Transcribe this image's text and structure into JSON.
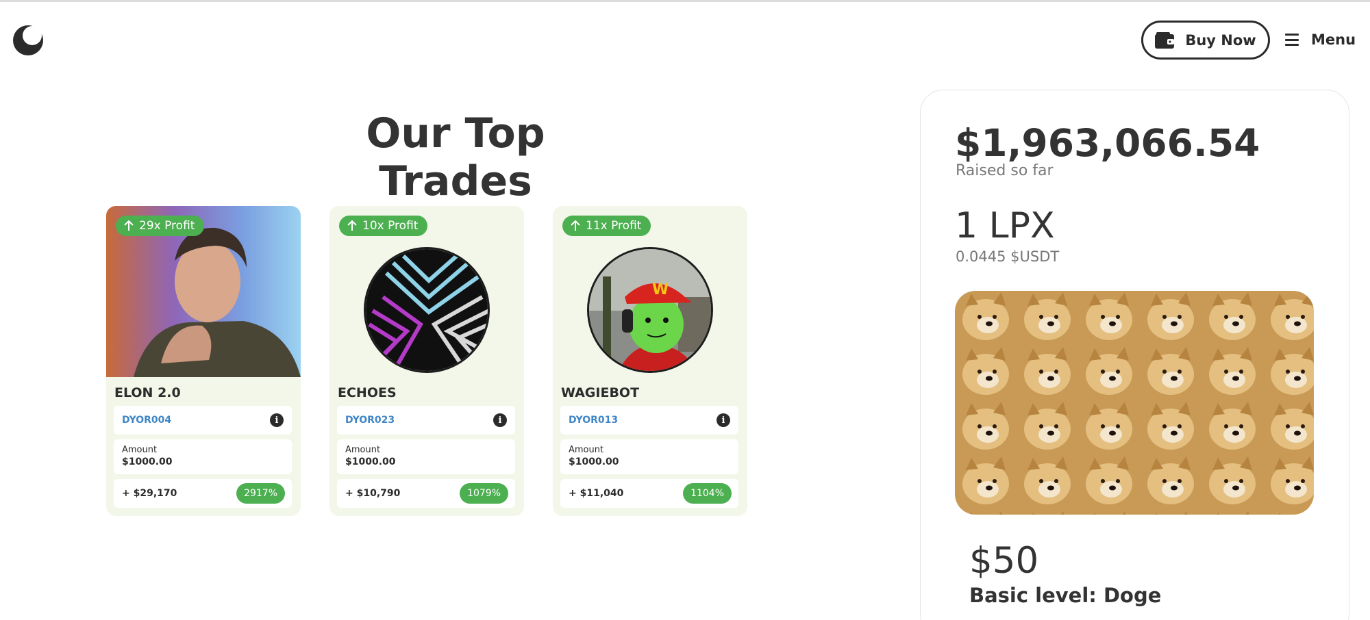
{
  "header": {
    "logo_icon": "crescent-logo",
    "buy_label": "Buy Now",
    "buy_icon": "wallet-icon",
    "menu_label": "Menu",
    "menu_icon": "hamburger-icon"
  },
  "section": {
    "title": "Our Top Trades"
  },
  "trades": [
    {
      "profit": "29x Profit",
      "name": "ELON 2.0",
      "code": "DYOR004",
      "amount_label": "Amount",
      "amount": "$1000.00",
      "gain": "+ $29,170",
      "percent": "2917%",
      "image": "portrait-photo"
    },
    {
      "profit": "10x Profit",
      "name": "ECHOES",
      "code": "DYOR023",
      "amount_label": "Amount",
      "amount": "$1000.00",
      "gain": "+ $10,790",
      "percent": "1079%",
      "image": "echoes-logo"
    },
    {
      "profit": "11x Profit",
      "name": "WAGIEBOT",
      "code": "DYOR013",
      "amount_label": "Amount",
      "amount": "$1000.00",
      "gain": "+ $11,040",
      "percent": "1104%",
      "image": "wagiebot-avatar"
    }
  ],
  "presale": {
    "raised": "$1,963,066.54",
    "raised_label": "Raised so far",
    "token": "1 LPX",
    "token_price": "0.0445 $USDT",
    "level_price": "$50",
    "level_name": "Basic level: Doge",
    "image": "doge-pattern"
  },
  "colors": {
    "accent": "#4caf50",
    "card_bg": "#f2f7e9",
    "code_text": "#3f86c6",
    "text": "#2b2b2b"
  }
}
